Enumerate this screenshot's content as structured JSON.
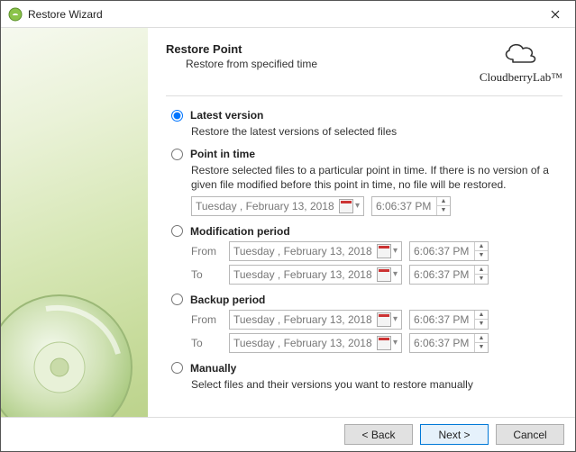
{
  "window": {
    "title": "Restore Wizard"
  },
  "header": {
    "title": "Restore Point",
    "subtitle": "Restore from specified time",
    "brand": "CloudberryLab™"
  },
  "options": {
    "latest": {
      "label": "Latest version",
      "desc": "Restore the latest versions of selected files"
    },
    "pit": {
      "label": "Point in time",
      "desc": "Restore selected files to a particular point in time. If there is no version of a given file modified before this point in time, no file will be restored.",
      "date": "Tuesday   ,  February   13, 2018",
      "time": "6:06:37 PM"
    },
    "mod": {
      "label": "Modification period",
      "fromLabel": "From",
      "toLabel": "To",
      "fromDate": "Tuesday ,  February  13, 2018",
      "fromTime": "6:06:37 PM",
      "toDate": "Tuesday ,  February  13, 2018",
      "toTime": "6:06:37 PM"
    },
    "bak": {
      "label": "Backup period",
      "fromLabel": "From",
      "toLabel": "To",
      "fromDate": "Tuesday ,  February  13, 2018",
      "fromTime": "6:06:37 PM",
      "toDate": "Tuesday ,  February  13, 2018",
      "toTime": "6:06:37 PM"
    },
    "manual": {
      "label": "Manually",
      "desc": "Select files and their versions you want to restore manually"
    }
  },
  "footer": {
    "back": "< Back",
    "next": "Next >",
    "cancel": "Cancel"
  }
}
